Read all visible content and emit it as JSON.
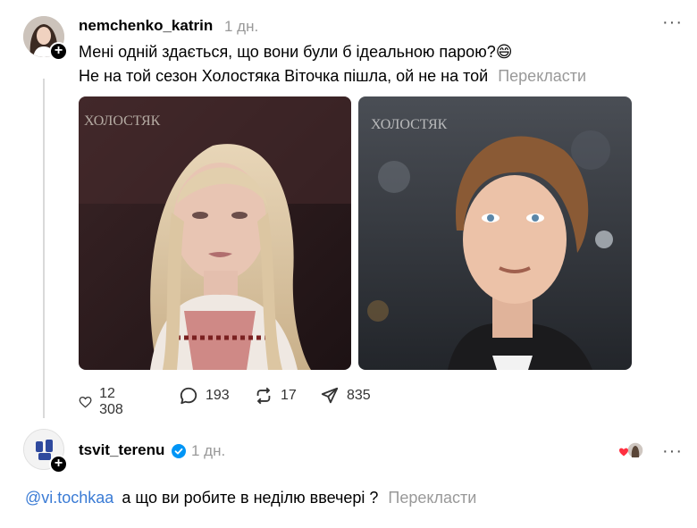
{
  "post": {
    "username": "nemchenko_katrin",
    "time": "1 дн.",
    "text_line1": "Мені одній здається, що вони були б ідеальною парою?",
    "emoji": "😄",
    "text_line2": "Не на той сезон Холостяка Віточка пішла, ой не на той",
    "translate_label": "Перекласти",
    "images": [
      {
        "watermark": "ХОЛОСТЯК"
      },
      {
        "watermark": "ХОЛОСТЯК"
      }
    ],
    "actions": {
      "likes": "12 308",
      "comments": "193",
      "reposts": "17",
      "shares": "835"
    },
    "more_label": "···"
  },
  "reply": {
    "username": "tsvit_terenu",
    "time": "1 дн.",
    "mention": "@vi.tochkaa",
    "text": "а що ви робите в неділю ввечері ?",
    "translate_label": "Перекласти",
    "more_label": "···"
  },
  "colors": {
    "muted": "#999999",
    "mention": "#3a7bd5",
    "verified": "#0095f6"
  }
}
